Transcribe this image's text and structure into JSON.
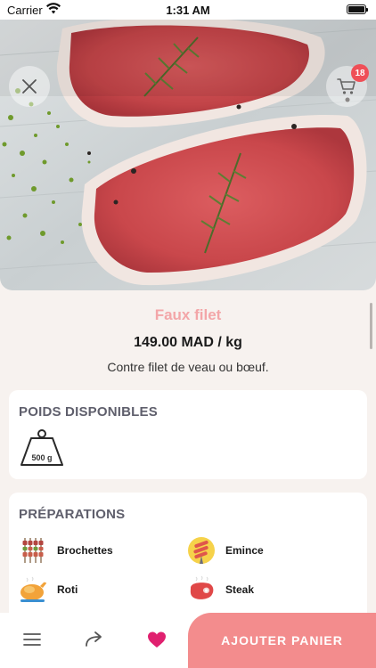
{
  "status_bar": {
    "carrier": "Carrier",
    "time": "1:31 AM"
  },
  "header": {
    "cart_count": "18"
  },
  "product": {
    "name": "Faux filet",
    "price": "149.00 MAD / kg",
    "description": "Contre filet de veau ou bœuf."
  },
  "weights": {
    "title": "POIDS DISPONIBLES",
    "options": [
      {
        "label": "500 g",
        "icon": "weight-icon"
      }
    ]
  },
  "preparations": {
    "title": "PRÉPARATIONS",
    "items": [
      {
        "label": "Brochettes",
        "icon": "skewers-icon"
      },
      {
        "label": "Emince",
        "icon": "sliced-meat-icon"
      },
      {
        "label": "Roti",
        "icon": "roast-chicken-icon"
      },
      {
        "label": "Steak",
        "icon": "steak-icon"
      }
    ]
  },
  "bottom_bar": {
    "add_to_cart_label": "AJOUTER PANIER"
  },
  "colors": {
    "accent": "#f38c8d",
    "title_pink": "#f3a6a8",
    "badge": "#ef4f57",
    "favorite": "#e0206f"
  }
}
